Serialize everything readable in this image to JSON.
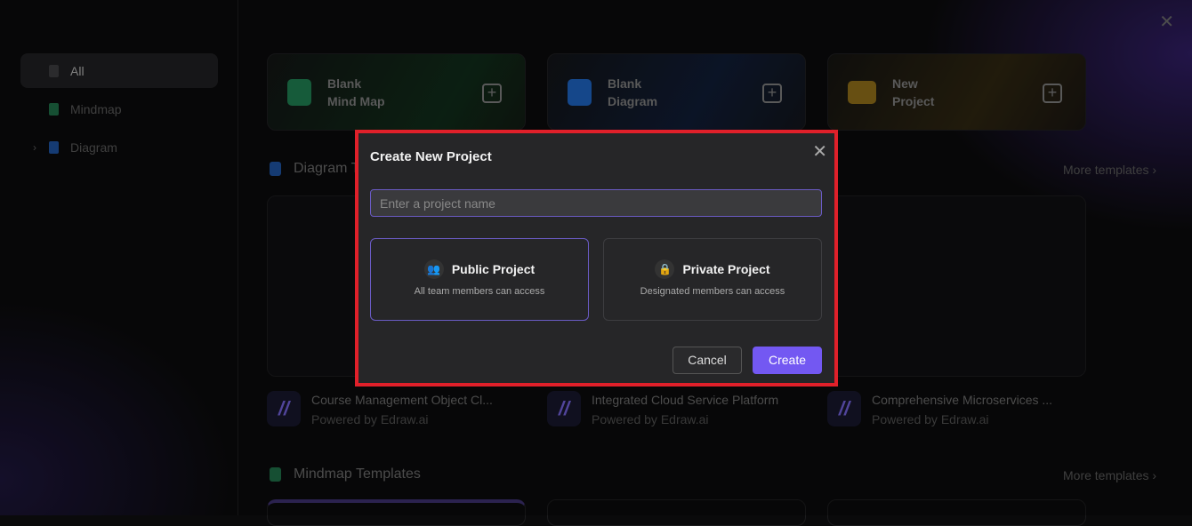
{
  "sidebar": {
    "items": [
      {
        "label": "All",
        "icon": "grid-icon"
      },
      {
        "label": "Mindmap",
        "icon": "mindmap-icon"
      },
      {
        "label": "Diagram",
        "icon": "diagram-icon"
      }
    ]
  },
  "quick_cards": [
    {
      "label1": "Blank",
      "label2": "Mind Map",
      "color": "#1e7a4e"
    },
    {
      "label1": "Blank",
      "label2": "Diagram",
      "color": "#1c5fb8"
    },
    {
      "label1": "New",
      "label2": "Project",
      "color": "#8a6a18"
    }
  ],
  "diagram_section": {
    "title": "Diagram Templates",
    "more": "More templates"
  },
  "templates": [
    {
      "name": "Course Management Object Cl...",
      "by": "Powered by Edraw.ai"
    },
    {
      "name": "Integrated Cloud Service Platform",
      "by": "Powered by Edraw.ai"
    },
    {
      "name": "Comprehensive Microservices ...",
      "by": "Powered by Edraw.ai"
    }
  ],
  "mindmap_section": {
    "title": "Mindmap Templates",
    "more": "More templates"
  },
  "dialog": {
    "title": "Create New Project",
    "placeholder": "Enter a project name",
    "value": "",
    "options": [
      {
        "title": "Public Project",
        "desc": "All team members can access",
        "selected": true
      },
      {
        "title": "Private Project",
        "desc": "Designated members can access",
        "selected": false
      }
    ],
    "cancel": "Cancel",
    "create": "Create"
  },
  "colors": {
    "accent": "#7358f2",
    "highlight": "#e0202a"
  }
}
